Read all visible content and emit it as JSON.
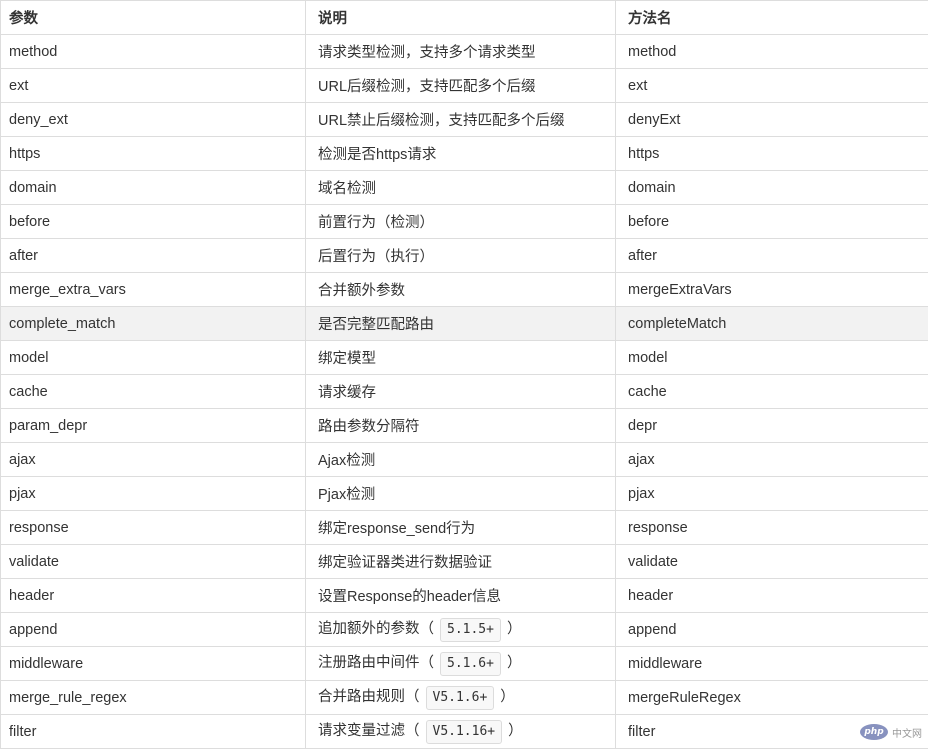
{
  "table": {
    "headers": [
      "参数",
      "说明",
      "方法名"
    ],
    "rows": [
      {
        "param": "method",
        "desc": "请求类型检测，支持多个请求类型",
        "method": "method"
      },
      {
        "param": "ext",
        "desc": "URL后缀检测，支持匹配多个后缀",
        "method": "ext"
      },
      {
        "param": "deny_ext",
        "desc": "URL禁止后缀检测，支持匹配多个后缀",
        "method": "denyExt"
      },
      {
        "param": "https",
        "desc": "检测是否https请求",
        "method": "https"
      },
      {
        "param": "domain",
        "desc": "域名检测",
        "method": "domain"
      },
      {
        "param": "before",
        "desc": "前置行为（检测）",
        "method": "before"
      },
      {
        "param": "after",
        "desc": "后置行为（执行）",
        "method": "after"
      },
      {
        "param": "merge_extra_vars",
        "desc": "合并额外参数",
        "method": "mergeExtraVars"
      },
      {
        "param": "complete_match",
        "desc": "是否完整匹配路由",
        "method": "completeMatch",
        "highlight": true
      },
      {
        "param": "model",
        "desc": "绑定模型",
        "method": "model"
      },
      {
        "param": "cache",
        "desc": "请求缓存",
        "method": "cache"
      },
      {
        "param": "param_depr",
        "desc": "路由参数分隔符",
        "method": "depr"
      },
      {
        "param": "ajax",
        "desc": "Ajax检测",
        "method": "ajax"
      },
      {
        "param": "pjax",
        "desc": "Pjax检测",
        "method": "pjax"
      },
      {
        "param": "response",
        "desc": "绑定response_send行为",
        "method": "response"
      },
      {
        "param": "validate",
        "desc": "绑定验证器类进行数据验证",
        "method": "validate"
      },
      {
        "param": "header",
        "desc": "设置Response的header信息",
        "method": "header"
      },
      {
        "param": "append",
        "desc": "追加额外的参数",
        "version": "5.1.5+",
        "method": "append"
      },
      {
        "param": "middleware",
        "desc": "注册路由中间件",
        "version": "5.1.6+",
        "method": "middleware"
      },
      {
        "param": "merge_rule_regex",
        "desc": "合并路由规则",
        "version": "V5.1.6+",
        "method": "mergeRuleRegex"
      },
      {
        "param": "filter",
        "desc": "请求变量过滤",
        "version": "V5.1.16+",
        "method": "filter"
      }
    ]
  },
  "watermark": {
    "logo": "php",
    "text": "中文网"
  }
}
